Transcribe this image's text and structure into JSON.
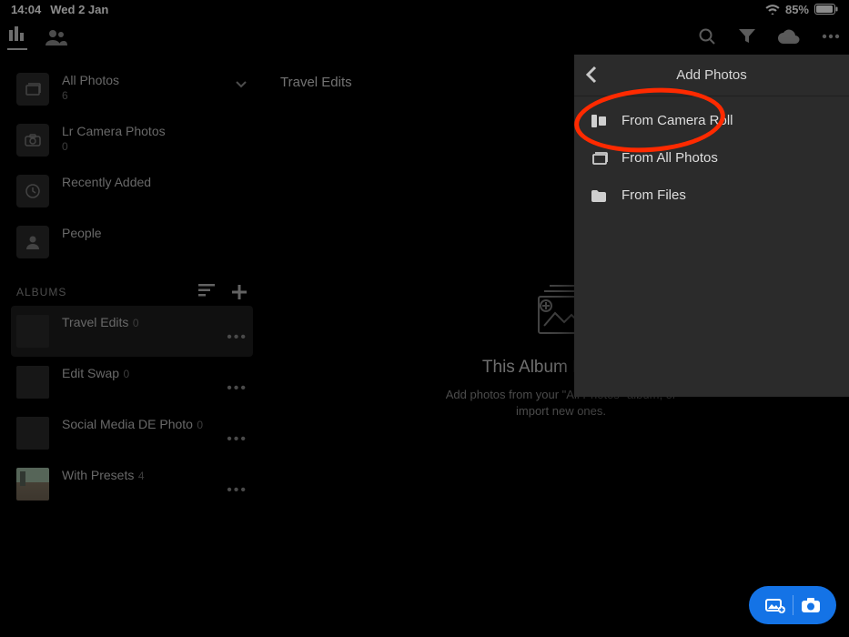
{
  "status": {
    "time": "14:04",
    "date": "Wed 2 Jan",
    "battery": "85%"
  },
  "topbar": {},
  "sidebar": {
    "items": [
      {
        "title": "All Photos",
        "count": "6"
      },
      {
        "title": "Lr Camera Photos",
        "count": "0"
      },
      {
        "title": "Recently Added",
        "count": ""
      },
      {
        "title": "People",
        "count": ""
      }
    ],
    "albums_header": "ALBUMS",
    "albums": [
      {
        "title": "Travel Edits",
        "count": "0"
      },
      {
        "title": "Edit Swap",
        "count": "0"
      },
      {
        "title": "Social Media DE Photo",
        "count": "0"
      },
      {
        "title": "With Presets",
        "count": "4"
      }
    ]
  },
  "main": {
    "title": "Travel Edits",
    "empty_title": "This Album Is Empty",
    "empty_sub_l1": "Add photos from your \"All Photos\" album, or",
    "empty_sub_l2": "import new ones."
  },
  "popup": {
    "title": "Add Photos",
    "items": [
      {
        "label": "From Camera Roll"
      },
      {
        "label": "From All Photos"
      },
      {
        "label": "From Files"
      }
    ]
  }
}
